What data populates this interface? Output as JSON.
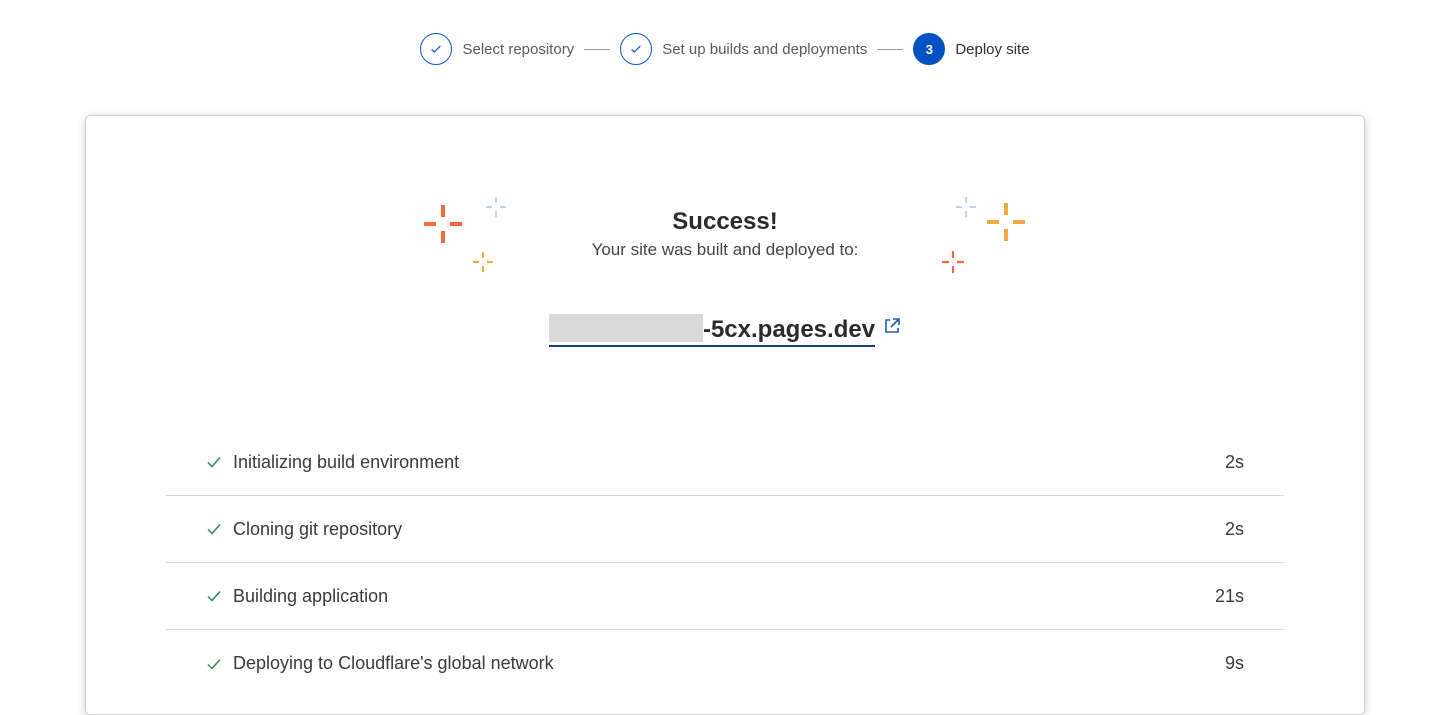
{
  "stepper": {
    "steps": [
      {
        "label": "Select repository",
        "state": "done"
      },
      {
        "label": "Set up builds and deployments",
        "state": "done"
      },
      {
        "label": "Deploy site",
        "number": "3",
        "state": "active"
      }
    ]
  },
  "result": {
    "title": "Success!",
    "subtitle": "Your site was built and deployed to:",
    "site_url_visible": "-5cx.pages.dev",
    "link_icon": "external-link-icon"
  },
  "build_steps": [
    {
      "name": "Initializing build environment",
      "duration": "2s"
    },
    {
      "name": "Cloning git repository",
      "duration": "2s"
    },
    {
      "name": "Building application",
      "duration": "21s"
    },
    {
      "name": "Deploying to Cloudflare's global network",
      "duration": "9s"
    }
  ],
  "colors": {
    "primary": "#0051c3",
    "success_check": "#2e8b57",
    "sparkle_orange": "#f26b38",
    "sparkle_amber": "#f5a742",
    "sparkle_blue": "#b9d6f5"
  }
}
